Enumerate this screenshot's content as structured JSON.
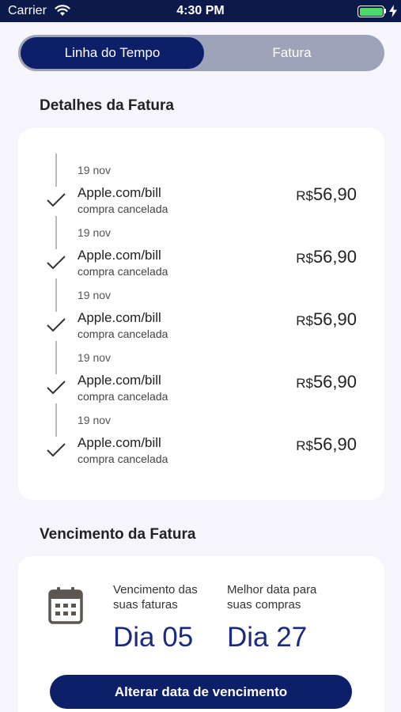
{
  "status_bar": {
    "carrier": "Carrier",
    "time": "4:30 PM"
  },
  "tabs": [
    {
      "label": "Linha do Tempo",
      "active": true
    },
    {
      "label": "Fatura",
      "active": false
    }
  ],
  "invoice_details": {
    "title": "Detalhes da Fatura",
    "items": [
      {
        "date": "19 nov",
        "merchant": "Apple.com/bill",
        "status": "compra cancelada",
        "currency": "R$",
        "amount": "56,90"
      },
      {
        "date": "19 nov",
        "merchant": "Apple.com/bill",
        "status": "compra cancelada",
        "currency": "R$",
        "amount": "56,90"
      },
      {
        "date": "19 nov",
        "merchant": "Apple.com/bill",
        "status": "compra cancelada",
        "currency": "R$",
        "amount": "56,90"
      },
      {
        "date": "19 nov",
        "merchant": "Apple.com/bill",
        "status": "compra cancelada",
        "currency": "R$",
        "amount": "56,90"
      },
      {
        "date": "19 nov",
        "merchant": "Apple.com/bill",
        "status": "compra cancelada",
        "currency": "R$",
        "amount": "56,90"
      }
    ]
  },
  "due": {
    "title": "Vencimento da Fatura",
    "icon": "calendar-icon",
    "due_label_1": "Vencimento das",
    "due_label_2": "suas faturas",
    "due_value": "Dia 05",
    "best_label_1": "Melhor data para",
    "best_label_2": "suas compras",
    "best_value": "Dia 27",
    "button_label": "Alterar data de vencimento"
  },
  "colors": {
    "primary": "#0e1f6a",
    "accent_text": "#1a2a84",
    "background": "#f5f5fb"
  }
}
